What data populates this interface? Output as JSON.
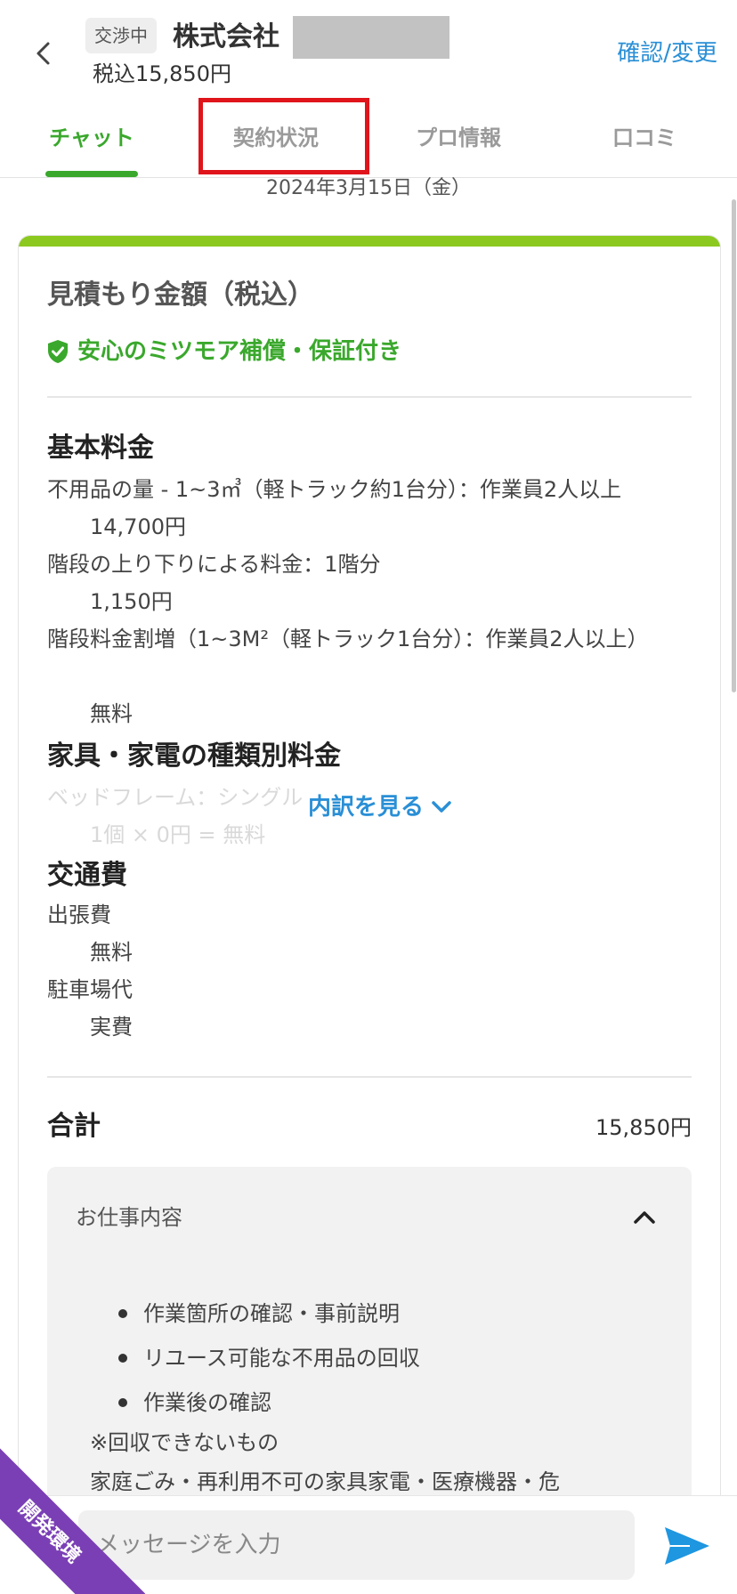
{
  "header": {
    "status_badge": "交渉中",
    "company_name": "株式会社",
    "price": "税込15,850円",
    "confirm_link": "確認/変更"
  },
  "tabs": [
    {
      "label": "チャット",
      "active": true
    },
    {
      "label": "契約状況",
      "active": false
    },
    {
      "label": "プロ情報",
      "active": false
    },
    {
      "label": "口コミ",
      "active": false
    }
  ],
  "date_label": "2024年3月15日（金）",
  "quote": {
    "title": "見積もり金額（税込）",
    "guarantee": "安心のミツモア補償・保証付き",
    "sections": {
      "basic": {
        "title": "基本料金",
        "items": [
          {
            "name": "不用品の量 - 1~3㎥（軽トラック約1台分）：作業員2人以上",
            "price": "14,700円"
          },
          {
            "name": "階段の上り下りによる料金：1階分",
            "price": "1,150円"
          },
          {
            "name": "階段料金割増（1~3M²（軽トラック1台分）：作業員2人以上）",
            "price": "無料"
          }
        ]
      },
      "furniture": {
        "title": "家具・家電の種類別料金",
        "items": [
          {
            "name": "ベッドフレーム：シングル",
            "price": "1個 × 0円 = 無料"
          }
        ],
        "breakdown_link": "内訳を見る"
      },
      "transport": {
        "title": "交通費",
        "items": [
          {
            "name": "出張費",
            "price": "無料"
          },
          {
            "name": "駐車場代",
            "price": "実費"
          }
        ]
      }
    },
    "total_label": "合計",
    "total_value": "15,850円"
  },
  "work": {
    "title": "お仕事内容",
    "items": [
      "作業箇所の確認・事前説明",
      "リユース可能な不用品の回収",
      "作業後の確認"
    ],
    "note_title": "※回収できないもの",
    "note_text": "家庭ごみ・再利用不可の家具家電・医療機器・危"
  },
  "message": {
    "placeholder": "メッセージを入力"
  },
  "dev_ribbon": "開発環境",
  "colors": {
    "accent_green": "#3aa82c",
    "link_blue": "#2a8fd6",
    "card_top": "#8cc920",
    "highlight_red": "#e0141b",
    "ribbon_purple": "#7b3fb5"
  }
}
